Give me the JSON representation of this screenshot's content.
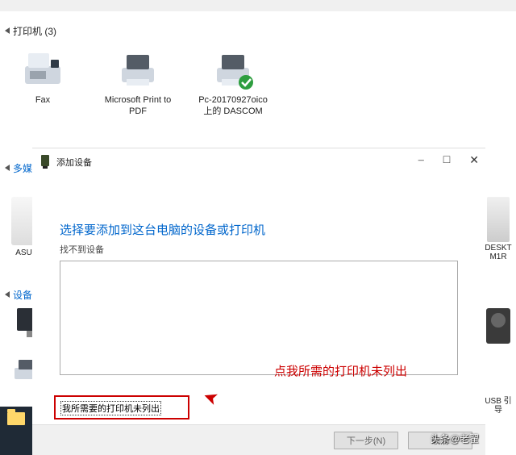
{
  "sections": {
    "printers_header": "打印机 (3)",
    "multimedia_header": "多媒",
    "devices_header": "设备"
  },
  "printers": [
    {
      "label": "Fax"
    },
    {
      "label": "Microsoft Print to PDF"
    },
    {
      "label": "Pc-20170927oico 上的 DASCOM"
    }
  ],
  "left_items": {
    "asus": "ASUS W",
    "printer_small": ""
  },
  "right_items": {
    "desktop": "DESKT M1R",
    "usb": "USB 引导"
  },
  "dialog": {
    "window_title": "添加设备",
    "heading": "选择要添加到这台电脑的设备或打印机",
    "sub": "找不到设备",
    "hint": "点我所需的打印机未列出",
    "link": "我所需要的打印机未列出",
    "next": "下一步(N)",
    "cancel": "取消",
    "minimize": "–",
    "maximize": "□",
    "close": "✕"
  },
  "watermark": "头条@老翟"
}
